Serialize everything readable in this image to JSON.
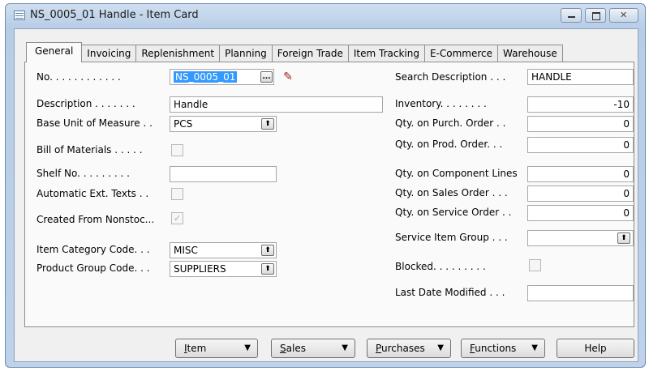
{
  "window": {
    "title": "NS_0005_01 Handle - Item Card"
  },
  "tabs": [
    "General",
    "Invoicing",
    "Replenishment",
    "Planning",
    "Foreign Trade",
    "Item Tracking",
    "E-Commerce",
    "Warehouse"
  ],
  "left": {
    "no_label": "No. . . . . . . . . . . .",
    "no_value": "NS_0005_01",
    "assist_edit": "...",
    "description_label": "Description . . . . . . .",
    "description_value": "Handle",
    "base_uom_label": "Base Unit of Measure . .",
    "base_uom_value": "PCS",
    "bom_label": "Bill of Materials . . . . .",
    "shelf_label": "Shelf No. . . . . . . . .",
    "shelf_value": "",
    "auto_ext_label": "Automatic Ext. Texts . .",
    "created_label": "Created From Nonstoc...",
    "created_checked": "✓",
    "item_cat_label": "Item Category Code. . .",
    "item_cat_value": "MISC",
    "prod_group_label": "Product Group Code. . .",
    "prod_group_value": "SUPPLIERS"
  },
  "right": {
    "search_label": "Search Description . . .",
    "search_value": "HANDLE",
    "inventory_label": "Inventory. . . . . . . .",
    "inventory_value": "-10",
    "purch_label": "Qty. on Purch. Order . .",
    "purch_value": "0",
    "prod_label": "Qty. on Prod. Order. . .",
    "prod_value": "0",
    "comp_label": "Qty. on Component Lines",
    "comp_value": "0",
    "sales_label": "Qty. on Sales Order . . .",
    "sales_value": "0",
    "service_label": "Qty. on Service Order . .",
    "service_value": "0",
    "svc_group_label": "Service Item Group . . .",
    "svc_group_value": "",
    "blocked_label": "Blocked. . . . . . . . .",
    "last_mod_label": "Last Date Modified . . .",
    "last_mod_value": ""
  },
  "buttons": {
    "item_u": "I",
    "item_rest": "tem",
    "sales_u": "S",
    "sales_rest": "ales",
    "purch_u": "P",
    "purch_rest": "urchases",
    "func_u": "F",
    "func_rest": "unctions",
    "help": "Help",
    "arrow": "▼"
  },
  "lookup_glyph": "⬆"
}
